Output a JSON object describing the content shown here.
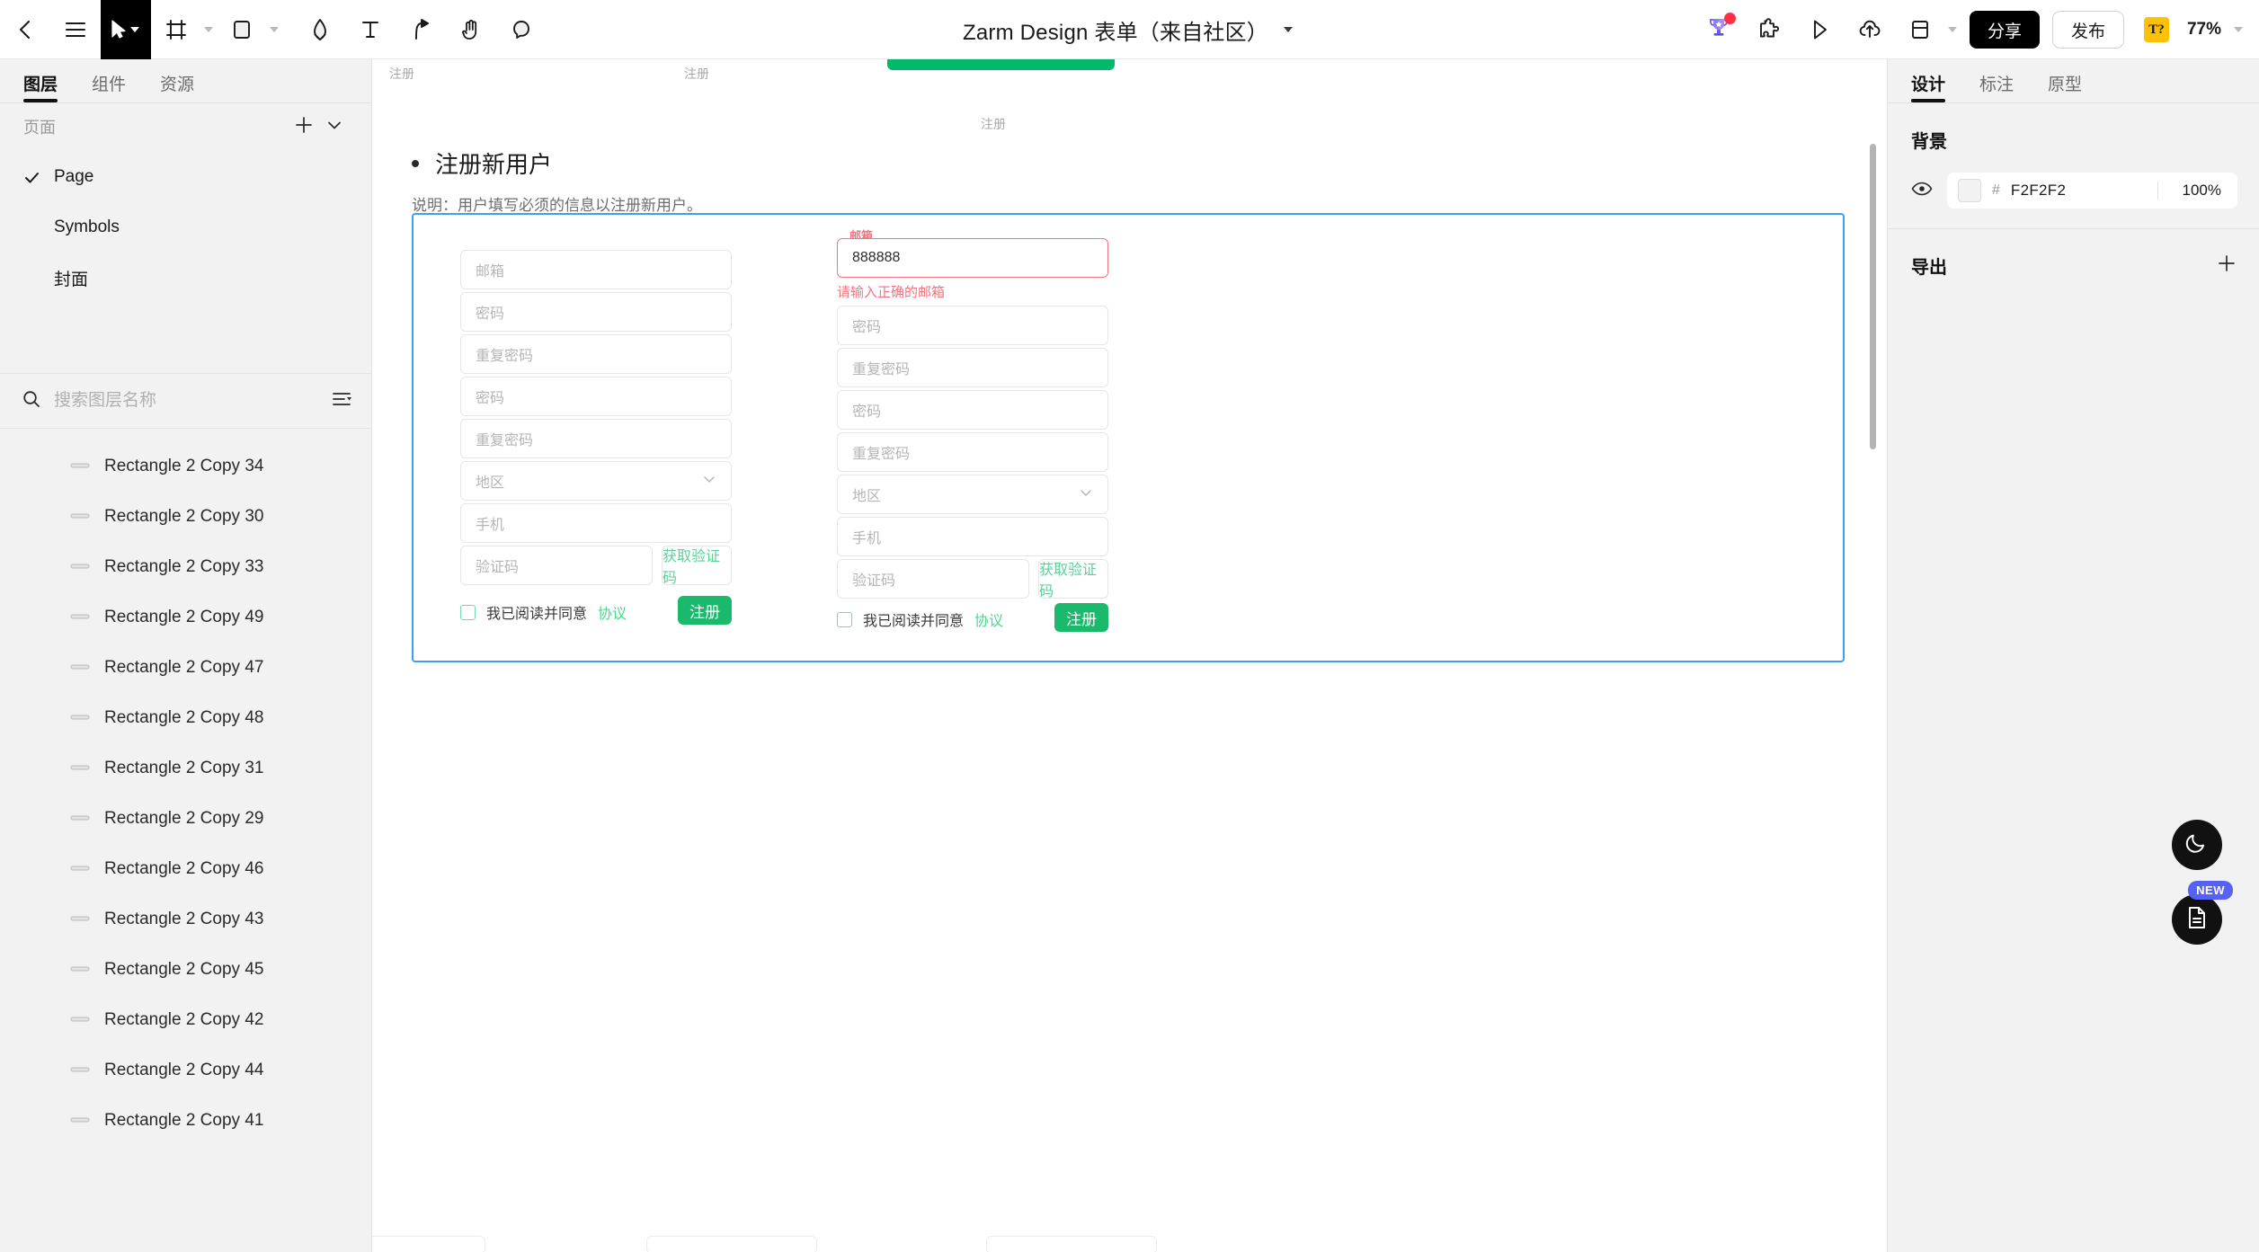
{
  "toolbar": {
    "title": "Zarm Design 表单（来自社区）",
    "share_label": "分享",
    "publish_label": "发布",
    "tq_label": "T?",
    "zoom_label": "77%",
    "icons": {
      "back": "back-arrow-icon",
      "menu": "hamburger-menu-icon",
      "cursor": "cursor-select-icon",
      "frame": "artboard-frame-icon",
      "shape": "rectangle-shape-icon",
      "pen": "pen-tool-icon",
      "text": "text-tool-icon",
      "path": "path-node-icon",
      "hand": "hand-pan-icon",
      "comment": "comment-bubble-icon",
      "trophy": "trophy-icon",
      "plugin": "plugin-puzzle-icon",
      "play": "play-preview-icon",
      "upload": "cloud-upload-icon",
      "layout": "layout-split-icon"
    }
  },
  "left_panel": {
    "tabs": [
      {
        "label": "图层",
        "active": true
      },
      {
        "label": "组件",
        "active": false
      },
      {
        "label": "资源",
        "active": false
      }
    ],
    "pages_section": {
      "title": "页面",
      "add_icon": "plus-icon",
      "collapse_icon": "chevron-down-icon",
      "items": [
        {
          "label": "Page",
          "selected": true
        },
        {
          "label": "Symbols",
          "selected": false
        },
        {
          "label": "封面",
          "selected": false
        }
      ]
    },
    "search": {
      "placeholder": "搜索图层名称",
      "value": "",
      "icon": "search-icon",
      "filter_icon": "sort-filter-icon"
    },
    "layers": [
      {
        "label": "Rectangle 2 Copy 34",
        "icon": "line-layer-icon"
      },
      {
        "label": "Rectangle 2 Copy 30",
        "icon": "line-layer-icon"
      },
      {
        "label": "Rectangle 2 Copy 33",
        "icon": "line-layer-icon"
      },
      {
        "label": "Rectangle 2 Copy 49",
        "icon": "line-layer-icon"
      },
      {
        "label": "Rectangle 2 Copy 47",
        "icon": "line-layer-icon"
      },
      {
        "label": "Rectangle 2 Copy 48",
        "icon": "line-layer-icon"
      },
      {
        "label": "Rectangle 2 Copy 31",
        "icon": "line-layer-icon"
      },
      {
        "label": "Rectangle 2 Copy 29",
        "icon": "line-layer-icon"
      },
      {
        "label": "Rectangle 2 Copy 46",
        "icon": "line-layer-icon"
      },
      {
        "label": "Rectangle 2 Copy 43",
        "icon": "line-layer-icon"
      },
      {
        "label": "Rectangle 2 Copy 45",
        "icon": "line-layer-icon"
      },
      {
        "label": "Rectangle 2 Copy 42",
        "icon": "line-layer-icon"
      },
      {
        "label": "Rectangle 2 Copy 44",
        "icon": "line-layer-icon"
      },
      {
        "label": "Rectangle 2 Copy 41",
        "icon": "line-layer-icon"
      }
    ]
  },
  "right_panel": {
    "tabs": [
      {
        "label": "设计",
        "active": true
      },
      {
        "label": "标注",
        "active": false
      },
      {
        "label": "原型",
        "active": false
      }
    ],
    "background": {
      "title": "背景",
      "visibility_icon": "eye-icon",
      "hash": "#",
      "hex": "F2F2F2",
      "opacity": "100%"
    },
    "export": {
      "title": "导出",
      "add_icon": "plus-icon"
    }
  },
  "canvas": {
    "selection_color": "#3B9FF3",
    "top_frame_labels": [
      "注册",
      "注册",
      "注册"
    ],
    "section": {
      "title": "注册新用户",
      "description": "说明：用户填写必须的信息以注册新用户。"
    },
    "form_left": {
      "fields": [
        {
          "placeholder": "邮箱",
          "value": "",
          "type": "text"
        },
        {
          "placeholder": "密码",
          "value": "",
          "type": "text"
        },
        {
          "placeholder": "重复密码",
          "value": "",
          "type": "text"
        },
        {
          "placeholder": "密码",
          "value": "",
          "type": "text"
        },
        {
          "placeholder": "重复密码",
          "value": "",
          "type": "text"
        },
        {
          "placeholder": "地区",
          "value": "",
          "type": "select"
        },
        {
          "placeholder": "手机",
          "value": "",
          "type": "text"
        },
        {
          "placeholder": "验证码",
          "value": "",
          "type": "text"
        }
      ],
      "get_code_label": "获取验证码",
      "agree_text": "我已阅读并同意",
      "agree_link": "协议",
      "submit_label": "注册"
    },
    "form_right": {
      "error_field": {
        "label": "邮箱",
        "value": "888888",
        "error_message": "请输入正确的邮箱",
        "error_color": "#F5737F"
      },
      "fields": [
        {
          "placeholder": "密码",
          "value": "",
          "type": "text"
        },
        {
          "placeholder": "重复密码",
          "value": "",
          "type": "text"
        },
        {
          "placeholder": "密码",
          "value": "",
          "type": "text"
        },
        {
          "placeholder": "重复密码",
          "value": "",
          "type": "text"
        },
        {
          "placeholder": "地区",
          "value": "",
          "type": "select"
        },
        {
          "placeholder": "手机",
          "value": "",
          "type": "text"
        },
        {
          "placeholder": "验证码",
          "value": "",
          "type": "text"
        }
      ],
      "get_code_label": "获取验证码",
      "agree_text": "我已阅读并同意",
      "agree_link": "协议",
      "submit_label": "注册"
    }
  },
  "fabs": {
    "theme_icon": "moon-icon",
    "docs_icon": "document-icon",
    "new_badge": "NEW"
  }
}
